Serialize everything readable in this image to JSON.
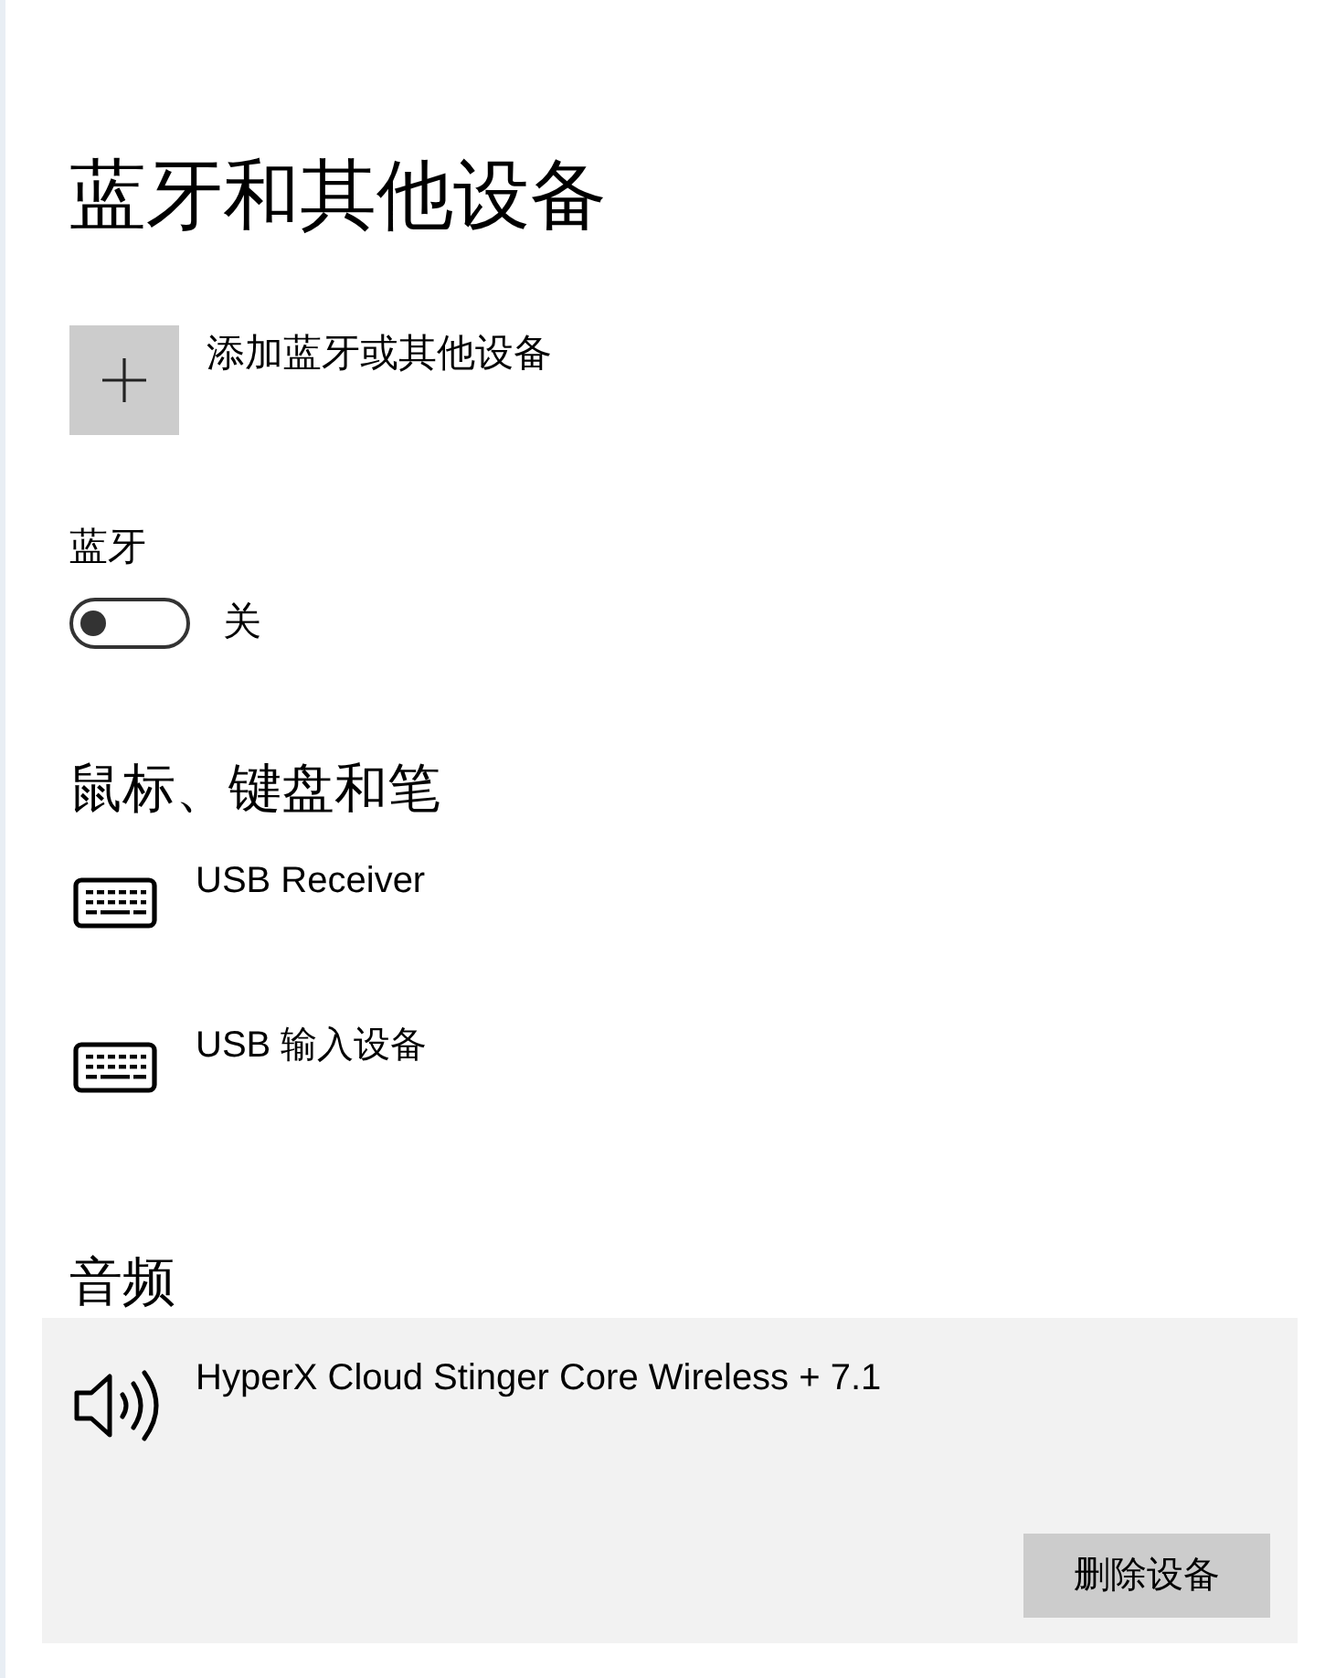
{
  "title": "蓝牙和其他设备",
  "add_device": {
    "label": "添加蓝牙或其他设备"
  },
  "bluetooth": {
    "label": "蓝牙",
    "on": false,
    "state_text": "关"
  },
  "sections": [
    {
      "heading": "鼠标、键盘和笔",
      "devices": [
        {
          "kind": "keyboard",
          "name": "USB Receiver",
          "selected": false
        },
        {
          "kind": "keyboard",
          "name": "USB 输入设备",
          "selected": false
        }
      ]
    },
    {
      "heading": "音频",
      "devices": [
        {
          "kind": "speaker",
          "name": "HyperX Cloud Stinger Core Wireless + 7.1",
          "selected": true,
          "action": "删除设备"
        }
      ]
    }
  ]
}
